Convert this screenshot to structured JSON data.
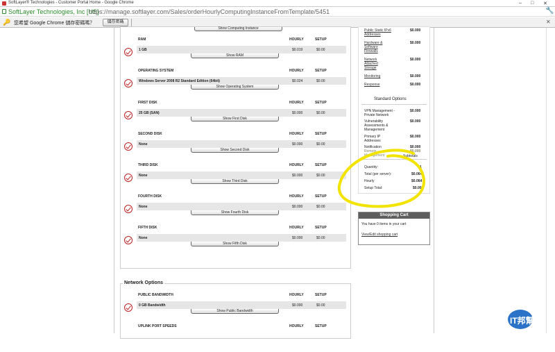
{
  "window": {
    "title": "SoftLayer® Technologies - Customer Portal Home - Google Chrome",
    "controls": [
      "–",
      "□",
      "✕"
    ]
  },
  "address": {
    "secure_label": "SoftLayer Technologies, Inc [US]",
    "url": "https://manage.softlayer.com/Sales/orderHourlyComputingInstanceFromTemplate/5451"
  },
  "infobar": {
    "message": "您希望 Google Chrome 儲存密碼嗎？",
    "save_button": "儲存密碼"
  },
  "top_button": {
    "label": "Show Computing Instance"
  },
  "sections": [
    {
      "name": "RAM",
      "value": "1 GB",
      "hourly": "$0.019",
      "setup": "$0.00",
      "button": "Show RAM"
    },
    {
      "name": "OPERATING SYSTEM",
      "value": "Windows Server 2008 R2 Standard Edition (64bit)",
      "hourly": "$0.024",
      "setup": "$0.00",
      "button": "Show Operating System"
    },
    {
      "name": "FIRST DISK",
      "value": "25 GB (SAN)",
      "hourly": "$0.000",
      "setup": "$0.00",
      "button": "Show First Disk"
    },
    {
      "name": "SECOND DISK",
      "value": "None",
      "hourly": "$0.000",
      "setup": "$0.00",
      "button": "Show Second Disk"
    },
    {
      "name": "THIRD DISK",
      "value": "None",
      "hourly": "$0.000",
      "setup": "$0.00",
      "button": "Show Third Disk"
    },
    {
      "name": "FOURTH DISK",
      "value": "None",
      "hourly": "$0.000",
      "setup": "$0.00",
      "button": "Show Fourth Disk"
    },
    {
      "name": "FIFTH DISK",
      "value": "None",
      "hourly": "$0.000",
      "setup": "$0.00",
      "button": "Show Fifth Disk"
    }
  ],
  "network": {
    "title": "Network Options",
    "sections": [
      {
        "name": "PUBLIC BANDWIDTH",
        "value": "0 GB Bandwidth",
        "hourly": "$0.000",
        "setup": "$0.00",
        "button": "Show Public Bandwidth"
      },
      {
        "name": "UPLINK PORT SPEEDS",
        "value": "",
        "hourly": "",
        "setup": "",
        "button": ""
      }
    ]
  },
  "headers": {
    "hourly": "HOURLY",
    "setup": "SETUP"
  },
  "sidebar": {
    "links": [
      {
        "label": "Public Static IPv6 Addresses",
        "value": "$0.000"
      },
      {
        "label": "Hardware & Software Firewalls",
        "value": "$0.000"
      },
      {
        "label": "Network Attached Storage",
        "value": "$0.000"
      },
      {
        "label": "Monitoring",
        "value": "$0.000"
      },
      {
        "label": "Response",
        "value": "$0.000"
      }
    ],
    "standard_title": "Standard Options",
    "standard": [
      {
        "label": "VPN Management - Private Network",
        "value": "$0.000"
      },
      {
        "label": "Vulnerability Assessments & Management",
        "value": "$0.000"
      },
      {
        "label": "Primary IP Addresses",
        "value": "$0.000"
      },
      {
        "label": "Notification",
        "value": "$0.000"
      },
      {
        "label": "Remote Management",
        "value": "$0.000"
      }
    ],
    "subtotal_label": "Subtotals",
    "totals": [
      {
        "label": "Quantity:",
        "value": "1"
      },
      {
        "label": "Total (per server):",
        "value": "$0.064"
      },
      {
        "label": "Hourly",
        "value": "$0.064"
      },
      {
        "label": "Setup Total:",
        "value": "$0.00"
      }
    ]
  },
  "cart": {
    "title": "Shopping Cart",
    "text": "You have 0 items in your cart",
    "link": "View/Edit shopping cart"
  },
  "watermark": {
    "text": "IT邦幫忙"
  },
  "colors": {
    "secure_green": "#2a8a2a",
    "check_red": "#b22222",
    "highlight_yellow": "#f2e300",
    "cart_header": "#5e5e5e"
  }
}
